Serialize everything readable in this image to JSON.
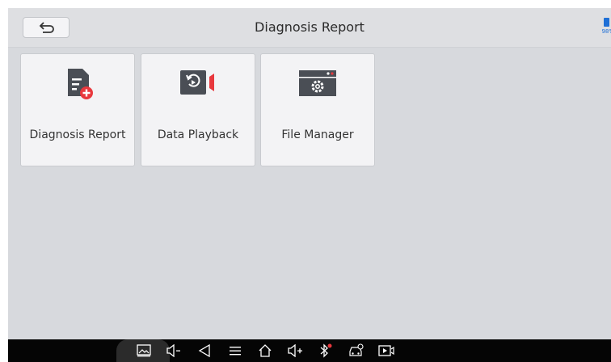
{
  "header": {
    "title": "Diagnosis Report",
    "back_icon": "back-arrow-icon"
  },
  "status": {
    "battery_percent": "98%",
    "battery_color": "#1e6fd6"
  },
  "tiles": [
    {
      "label": "Diagnosis Report",
      "icon": "document-add-icon"
    },
    {
      "label": "Data Playback",
      "icon": "playback-video-icon"
    },
    {
      "label": "File Manager",
      "icon": "settings-window-icon"
    }
  ],
  "navbar": {
    "items": [
      "screenshot-icon",
      "volume-down-icon",
      "back-triangle-icon",
      "menu-icon",
      "home-icon",
      "volume-up-icon",
      "bluetooth-icon",
      "car-diagnostic-icon",
      "screen-record-icon"
    ]
  },
  "colors": {
    "accent_red": "#e8383d",
    "icon_gray": "#4a4e55"
  }
}
